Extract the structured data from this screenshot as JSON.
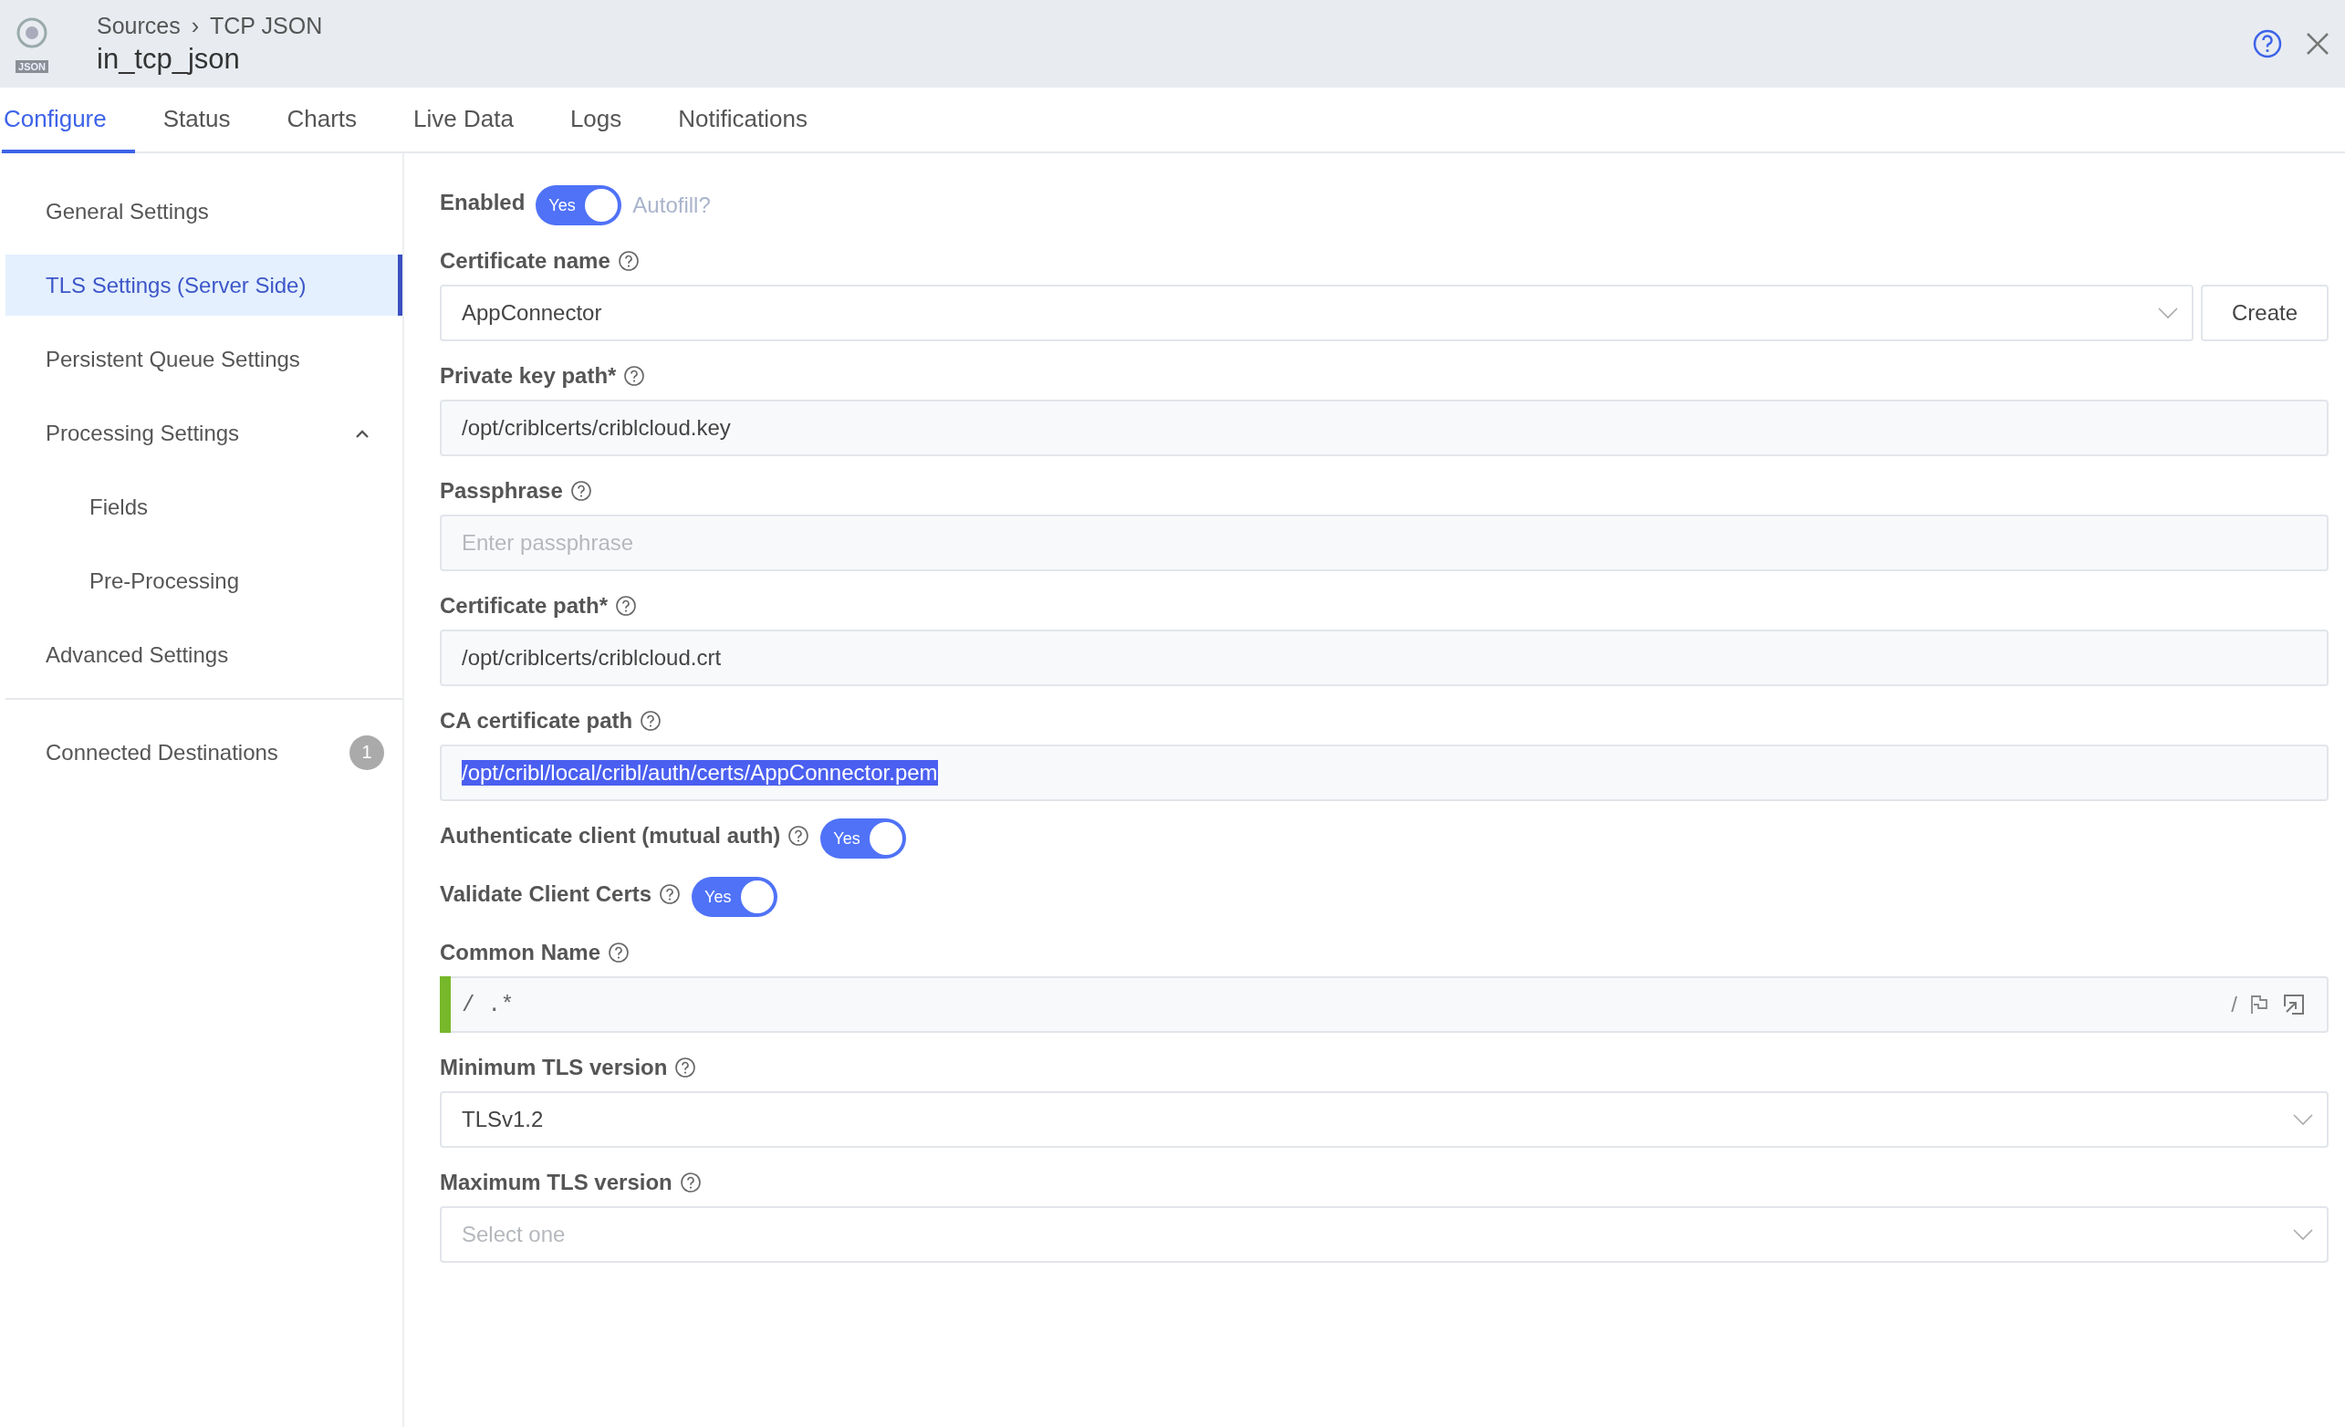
{
  "header": {
    "logo_text": "JSON",
    "breadcrumb": [
      "Sources",
      "TCP JSON"
    ],
    "separator": "›",
    "title": "in_tcp_json"
  },
  "tabs": [
    {
      "label": "Configure",
      "selected": true
    },
    {
      "label": "Status",
      "selected": false
    },
    {
      "label": "Charts",
      "selected": false
    },
    {
      "label": "Live Data",
      "selected": false
    },
    {
      "label": "Logs",
      "selected": false
    },
    {
      "label": "Notifications",
      "selected": false
    }
  ],
  "sidebar": {
    "items": [
      {
        "label": "General Settings",
        "selected": false
      },
      {
        "label": "TLS Settings (Server Side)",
        "selected": true
      },
      {
        "label": "Persistent Queue Settings",
        "selected": false
      },
      {
        "label": "Processing Settings",
        "selected": false,
        "expanded": true,
        "children": [
          {
            "label": "Fields",
            "selected": false
          },
          {
            "label": "Pre-Processing",
            "selected": false
          }
        ]
      },
      {
        "label": "Advanced Settings",
        "selected": false
      }
    ],
    "footer_items": [
      {
        "label": "Connected Destinations",
        "selected": false,
        "badge": "1"
      }
    ]
  },
  "form": {
    "fields": [
      {
        "kind": "toggle",
        "label": "Enabled",
        "help": false,
        "on": true,
        "toggle_text": "Yes",
        "link": "Autofill?"
      },
      {
        "kind": "select",
        "label": "Certificate name",
        "help": true,
        "value": "AppConnector",
        "button": "Create"
      },
      {
        "kind": "text",
        "label": "Private key path*",
        "help": true,
        "value": "/opt/criblcerts/criblcloud.key"
      },
      {
        "kind": "text",
        "label": "Passphrase",
        "help": true,
        "placeholder": "Enter passphrase"
      },
      {
        "kind": "text",
        "label": "Certificate path*",
        "help": true,
        "value": "/opt/criblcerts/criblcloud.crt"
      },
      {
        "kind": "text",
        "label": "CA certificate path",
        "help": true,
        "value": "/opt/cribl/local/cribl/auth/certs/AppConnector.pem",
        "text_selected": true
      },
      {
        "kind": "toggle",
        "label": "Authenticate client (mutual auth)",
        "help": true,
        "on": true,
        "toggle_text": "Yes"
      },
      {
        "kind": "toggle",
        "label": "Validate Client Certs",
        "help": true,
        "on": true,
        "toggle_text": "Yes"
      },
      {
        "kind": "regex",
        "label": "Common Name",
        "help": true,
        "prefix": "/",
        "value": ".*",
        "suffix": "/",
        "valid": true
      },
      {
        "kind": "select",
        "label": "Minimum TLS version",
        "help": true,
        "value": "TLSv1.2"
      },
      {
        "kind": "select",
        "label": "Maximum TLS version",
        "help": true,
        "placeholder": "Select one"
      }
    ]
  }
}
